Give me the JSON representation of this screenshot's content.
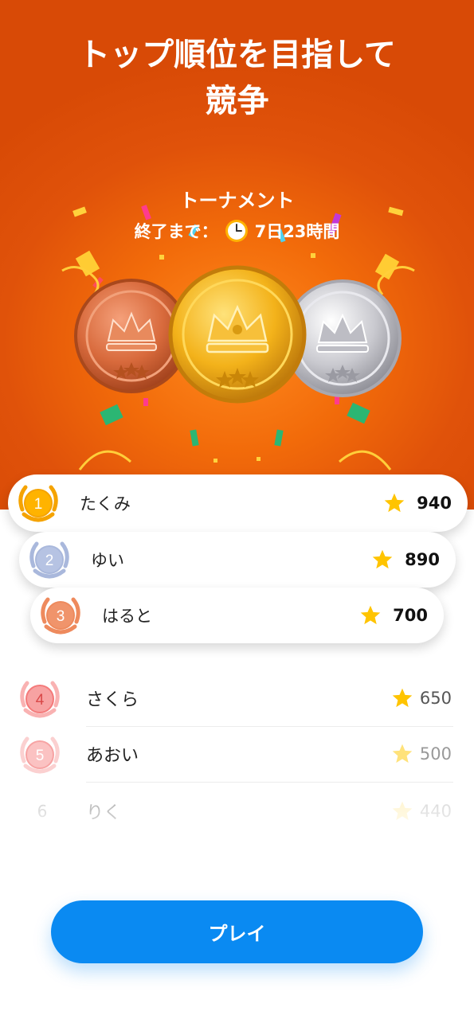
{
  "header": {
    "title_line1": "トップ順位を目指して",
    "title_line2": "競争"
  },
  "tournament": {
    "title": "トーナメント",
    "ends_label": "終了まで：",
    "time_left": "7日23時間"
  },
  "medals": [
    "bronze-medal",
    "gold-medal",
    "silver-medal"
  ],
  "leaderboard": {
    "top": [
      {
        "rank": "1",
        "name": "たくみ",
        "score": "940",
        "badge_color": "#f5a300"
      },
      {
        "rank": "2",
        "name": "ゆい",
        "score": "890",
        "badge_color": "#a9b8dc"
      },
      {
        "rank": "3",
        "name": "はると",
        "score": "700",
        "badge_color": "#ee8a5d"
      }
    ],
    "rest": [
      {
        "rank": "4",
        "name": "さくら",
        "score": "650",
        "badge_color": "#f47a7a"
      },
      {
        "rank": "5",
        "name": "あおい",
        "score": "500",
        "badge_color": "#f7a3a3"
      },
      {
        "rank": "6",
        "name": "りく",
        "score": "440"
      }
    ]
  },
  "play_button": {
    "label": "プレイ"
  },
  "colors": {
    "hero_orange": "#e0520a",
    "accent_blue": "#0a8af2",
    "star": "#ffc400",
    "gold": "#f5a300"
  }
}
